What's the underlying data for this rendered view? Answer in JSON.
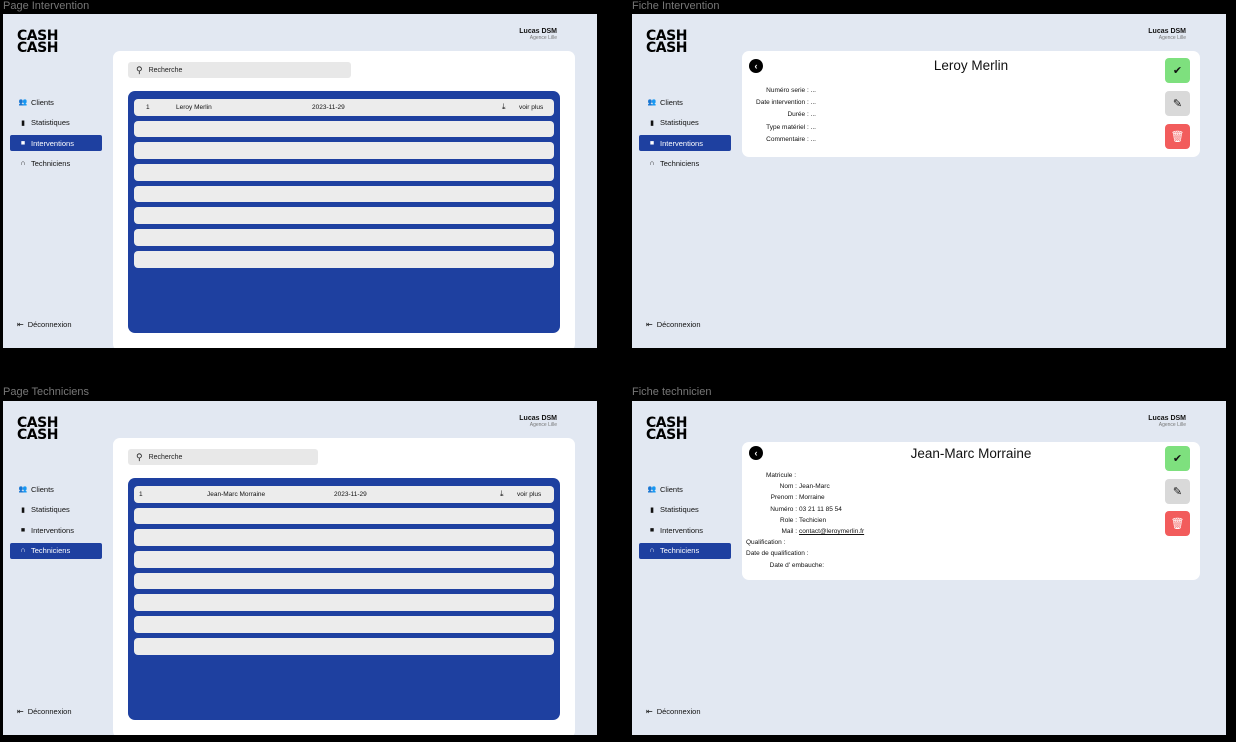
{
  "frames": {
    "f1": "Page Intervention",
    "f2": "Fiche Intervention",
    "f3": "Page Techniciens",
    "f4": "Fiche technicien"
  },
  "logo": {
    "line1": "CASH",
    "line2": "CASH"
  },
  "user": {
    "name": "Lucas DSM",
    "agency": "Agence Lille"
  },
  "nav": {
    "clients": "Clients",
    "stats": "Statistiques",
    "interventions": "Interventions",
    "techniciens": "Techniciens",
    "logout": "Déconnexion"
  },
  "search": {
    "placeholder": "Recherche"
  },
  "interventions_list": {
    "row1": {
      "num": "1",
      "client": "Leroy Merlin",
      "date": "2023-11-29",
      "more": "voir plus"
    }
  },
  "techniciens_list": {
    "row1": {
      "num": "1",
      "name": "Jean-Marc Morraine",
      "date": "2023-11-29",
      "more": "voir plus"
    }
  },
  "fiche_intervention": {
    "title": "Leroy Merlin",
    "fields": [
      "Numéro serie : ...",
      "Date intervention : ...",
      "Durée : ...",
      "Type matériel : ...",
      "Commentaire : ..."
    ]
  },
  "fiche_technicien": {
    "title": "Jean-Marc Morraine",
    "fields": {
      "matricule": {
        "label": "Matricule :",
        "value": ""
      },
      "nom": {
        "label": "Nom :",
        "value": "Jean-Marc"
      },
      "prenom": {
        "label": "Prenom :",
        "value": "Morraine"
      },
      "numero": {
        "label": "Numéro :",
        "value": "03 21 11 85 54"
      },
      "role": {
        "label": "Role :",
        "value": "Techicien"
      },
      "mail": {
        "label": "Mail :",
        "value": "contact@leroymerlin.fr"
      },
      "qualification": {
        "label": "Qualification :",
        "value": ""
      },
      "date_qualif": {
        "label": "Date de qualification :",
        "value": ""
      },
      "date_embauche": {
        "label": "Date d' embauche:",
        "value": ""
      }
    }
  },
  "colors": {
    "accent": "#1e40a0",
    "background": "#e2e8f2",
    "validate": "#7ee07e",
    "delete": "#f25c5c"
  },
  "icons": {
    "clients": "users-icon",
    "stats": "bar-chart-icon",
    "interventions": "truck-icon",
    "techniciens": "headset-icon",
    "logout": "logout-icon",
    "search": "search-icon",
    "download": "download-icon",
    "back": "back-icon",
    "validate": "check-icon",
    "edit": "edit-icon",
    "delete": "trash-icon"
  }
}
